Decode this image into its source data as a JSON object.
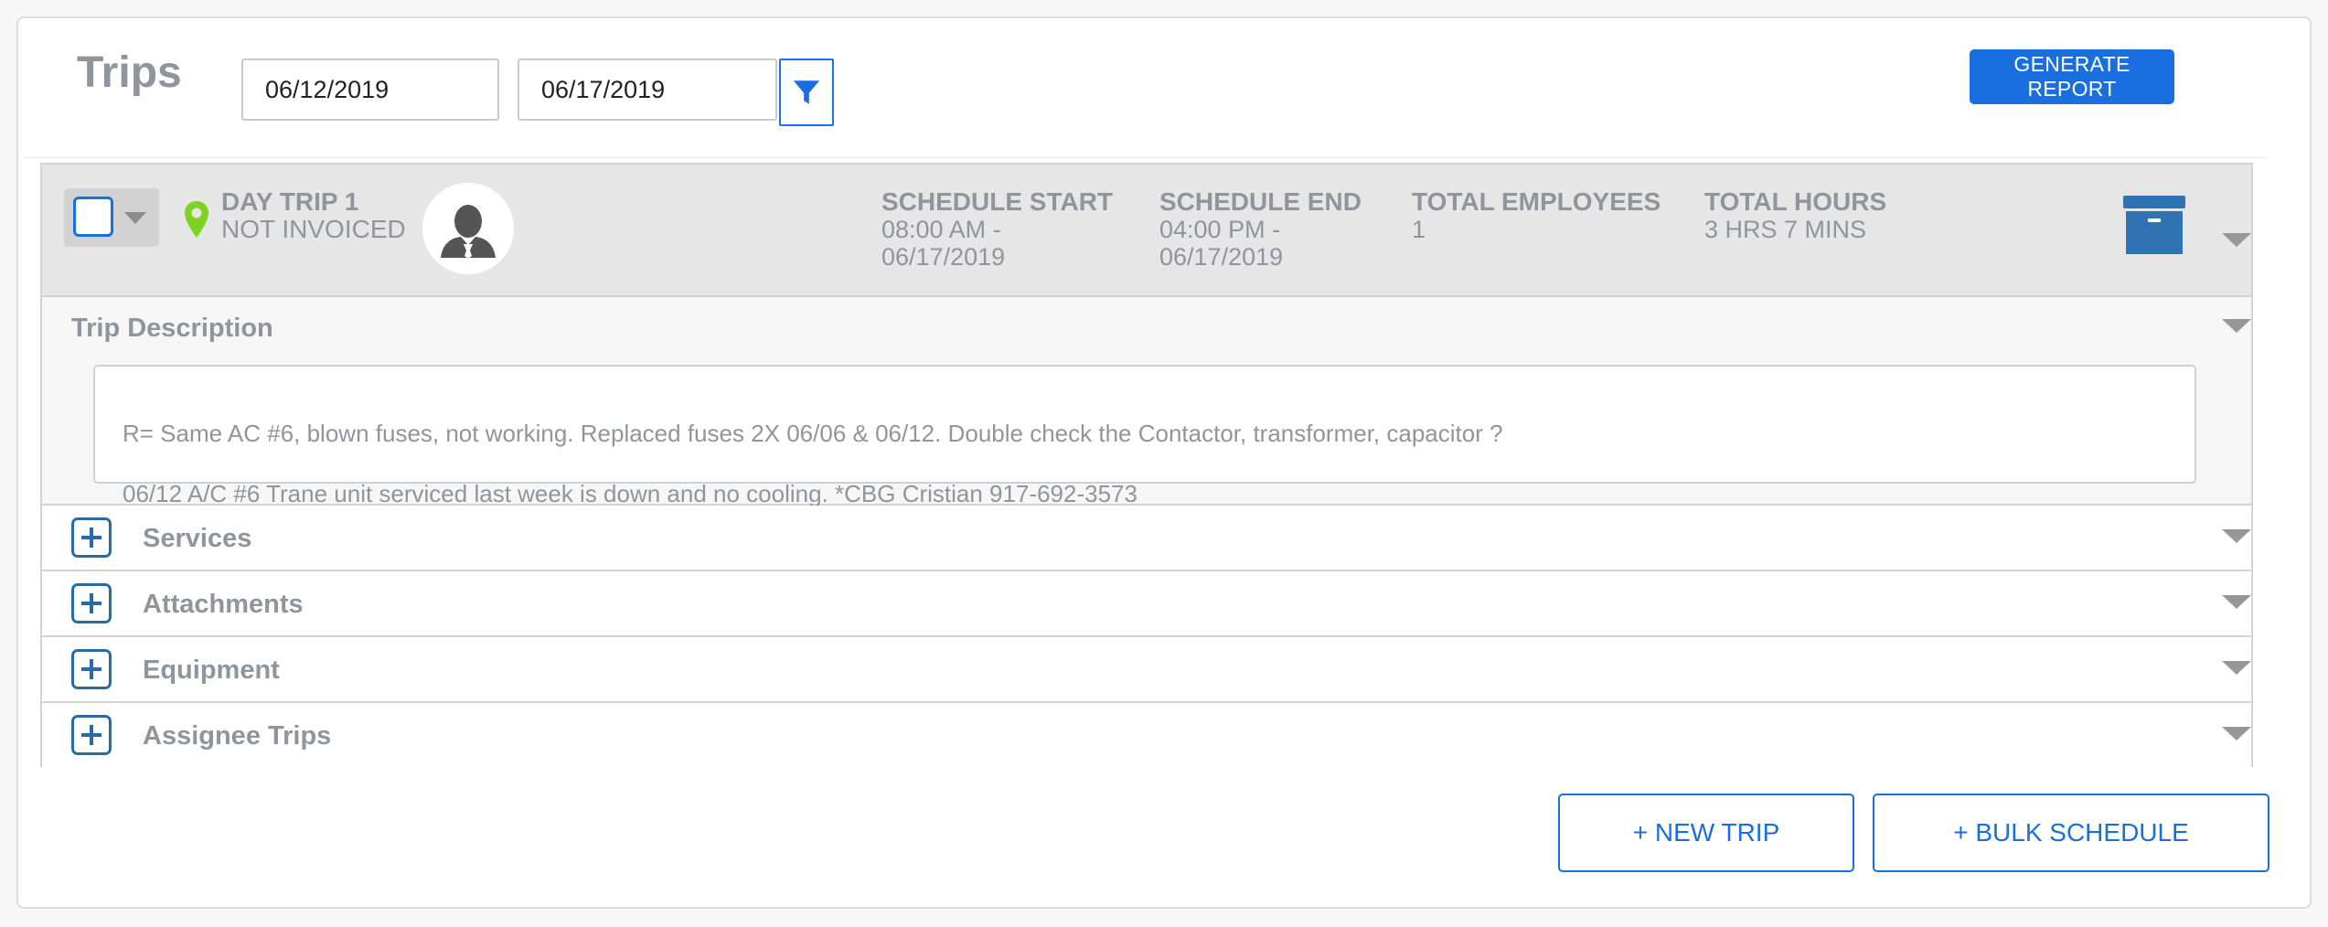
{
  "page": {
    "title": "Trips"
  },
  "filters": {
    "start_date": "06/12/2019",
    "end_date": "06/17/2019",
    "filter_icon": "filter-icon"
  },
  "actions": {
    "generate_report": "GENERATE REPORT"
  },
  "trip": {
    "name": "DAY TRIP 1",
    "status": "NOT INVOICED",
    "pin_icon": "location-pin-icon",
    "pin_color": "#7ed321",
    "avatar_icon": "technician-avatar-icon",
    "schedule_start": {
      "label": "SCHEDULE START",
      "time": "08:00 AM -",
      "date": "06/17/2019"
    },
    "schedule_end": {
      "label": "SCHEDULE END",
      "time": "04:00 PM -",
      "date": "06/17/2019"
    },
    "total_employees": {
      "label": "TOTAL EMPLOYEES",
      "value": "1"
    },
    "total_hours": {
      "label": "TOTAL HOURS",
      "value": "3 HRS 7 MINS"
    },
    "archive_icon": "archive-box-icon",
    "description": {
      "title": "Trip Description",
      "line1": "R= Same AC #6, blown fuses, not working. Replaced fuses 2X 06/06 & 06/12. Double check the Contactor, transformer, capacitor ?",
      "line2": "06/12 A/C #6 Trane unit serviced last week is down and no cooling. *CBG  Cristian 917-692-3573"
    },
    "sections": [
      {
        "label": "Services"
      },
      {
        "label": "Attachments"
      },
      {
        "label": "Equipment"
      },
      {
        "label": "Assignee Trips"
      }
    ]
  },
  "footer": {
    "new_trip": "+ NEW TRIP",
    "bulk_schedule": "+ BULK SCHEDULE"
  },
  "colors": {
    "accent": "#1a6fe0",
    "panel": "#e6e6e6",
    "text_muted": "#8f959c"
  }
}
